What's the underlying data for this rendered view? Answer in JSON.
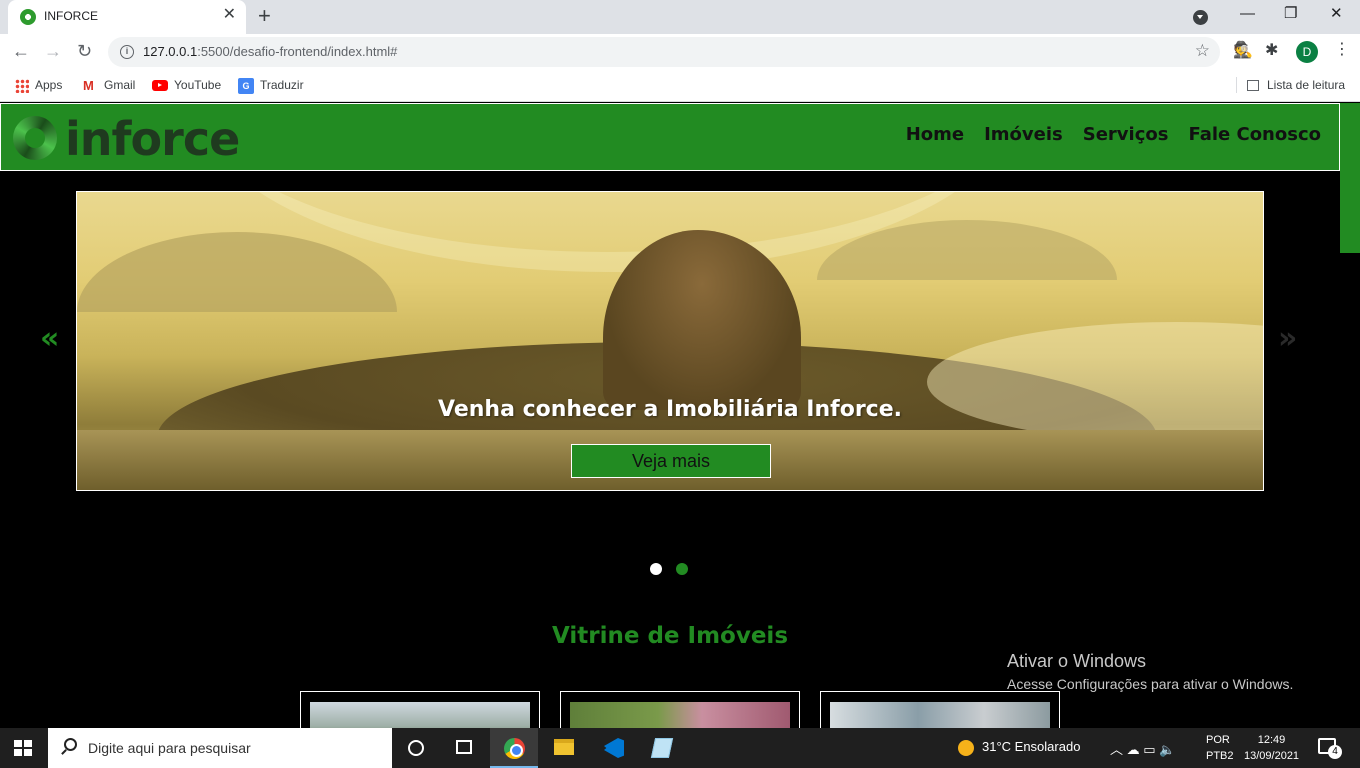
{
  "browser": {
    "tab_title": "INFORCE",
    "tab_close": "✕",
    "new_tab": "+",
    "url_host": "127.0.0.1",
    "url_rest": ":5500/desafio-frontend/index.html#",
    "profile_initial": "D",
    "win_minimize": "—",
    "win_restore": "❐",
    "win_close": "✕"
  },
  "bookmarks": [
    {
      "label": "Apps",
      "icon": "apps-icon"
    },
    {
      "label": "Gmail",
      "icon": "gmail-icon"
    },
    {
      "label": "YouTube",
      "icon": "youtube-icon"
    },
    {
      "label": "Traduzir",
      "icon": "translate-icon"
    }
  ],
  "reading_list": "Lista de leitura",
  "site": {
    "logo_text": "inforce",
    "nav": [
      "Home",
      "Imóveis",
      "Serviços",
      "Fale Conosco"
    ],
    "brand_color": "#228b22"
  },
  "carousel": {
    "caption": "Venha conhecer a Imobiliária Inforce.",
    "cta": "Veja mais",
    "prev": "«",
    "next": "»",
    "slide_count": 2,
    "active_slide": 1
  },
  "showcase": {
    "title": "Vitrine de Imóveis",
    "cards_visible": 3
  },
  "windows_watermark": {
    "title": "Ativar o Windows",
    "subtitle": "Acesse Configurações para ativar o Windows."
  },
  "taskbar": {
    "search_placeholder": "Digite aqui para pesquisar",
    "weather": "31°C  Ensolarado",
    "lang_line1": "POR",
    "lang_line2": "PTB2",
    "time": "12:49",
    "date": "13/09/2021",
    "notifications": "4"
  }
}
